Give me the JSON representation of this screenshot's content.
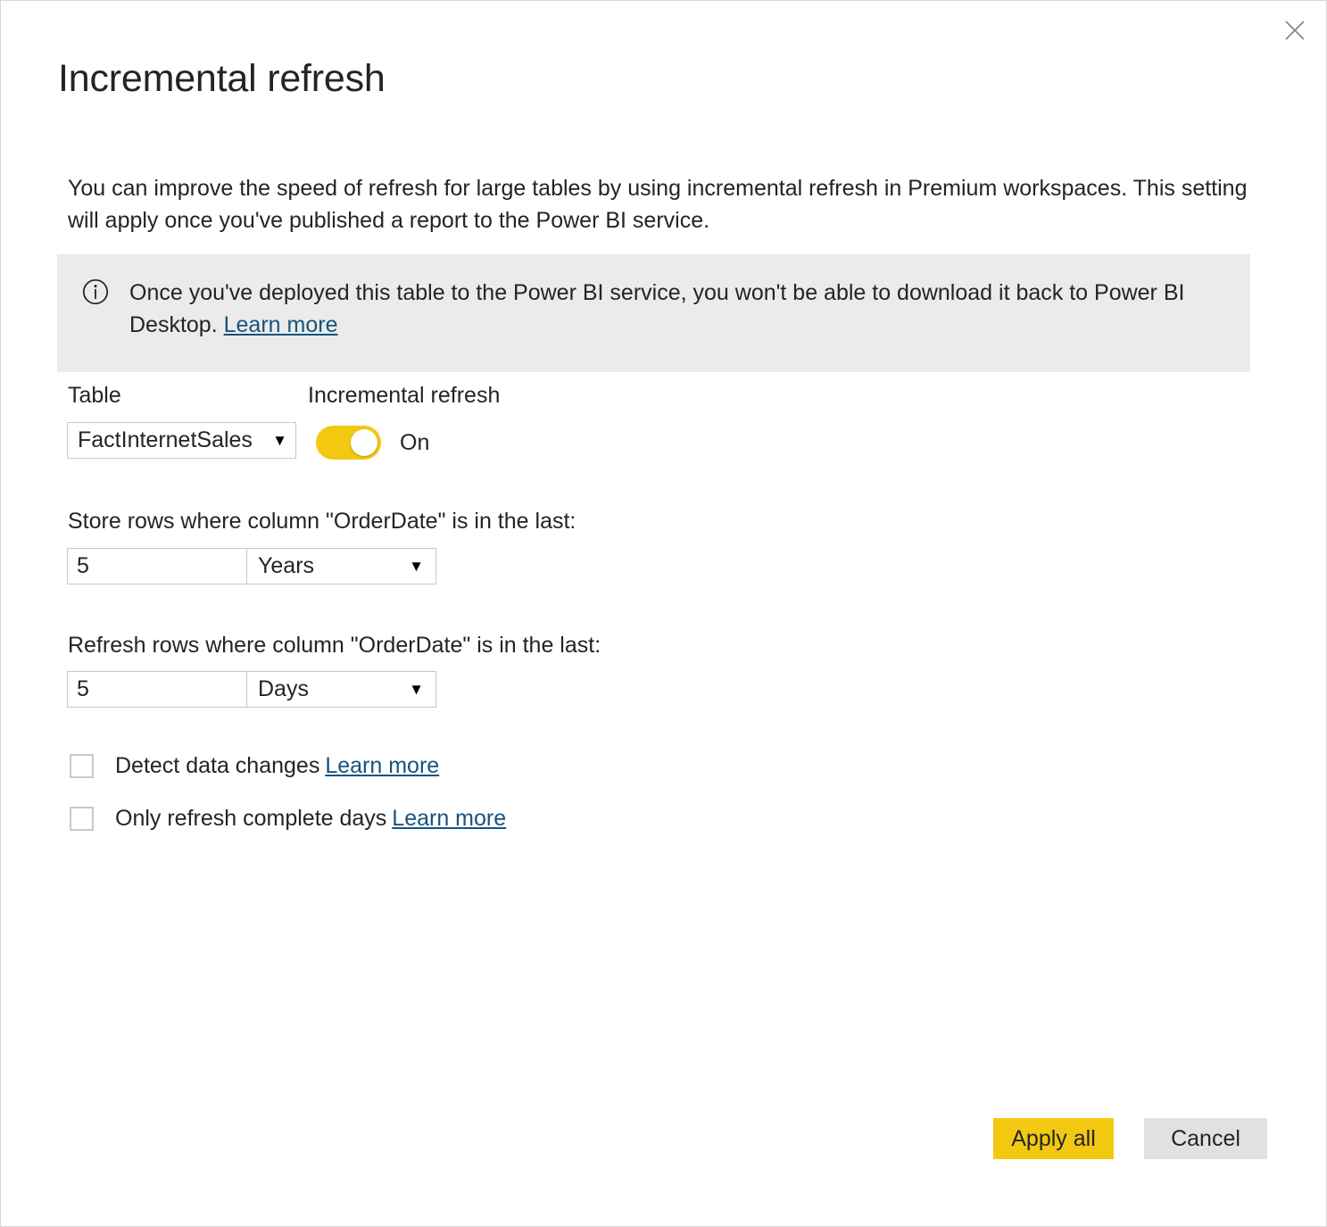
{
  "dialog": {
    "title": "Incremental refresh",
    "close_icon": "close-icon",
    "intro": "You can improve the speed of refresh for large tables by using incremental refresh in Premium workspaces. This setting will apply once you've published a report to the Power BI service."
  },
  "info_banner": {
    "icon": "info-icon",
    "text": "Once you've deployed this table to the Power BI service, you won't be able to download it back to Power BI Desktop.",
    "link_label": "Learn more"
  },
  "table_field": {
    "label": "Table",
    "selected": "FactInternetSales",
    "caret": "▼"
  },
  "incremental_refresh": {
    "label": "Incremental refresh",
    "state_label": "On",
    "enabled": true
  },
  "store_rows": {
    "label": "Store rows where column \"OrderDate\" is in the last:",
    "value": "5",
    "unit": "Years",
    "caret": "▼"
  },
  "refresh_rows": {
    "label": "Refresh rows where column \"OrderDate\" is in the last:",
    "value": "5",
    "unit": "Days",
    "caret": "▼"
  },
  "options": {
    "detect_data_changes": {
      "label": "Detect data changes",
      "link_label": "Learn more",
      "checked": false
    },
    "only_refresh_complete_days": {
      "label": "Only refresh complete days",
      "link_label": "Learn more",
      "checked": false
    }
  },
  "footer": {
    "apply_label": "Apply all",
    "cancel_label": "Cancel"
  },
  "colors": {
    "accent_yellow": "#f2c811",
    "link_blue": "#17537f",
    "banner_bg": "#ebebeb",
    "cancel_bg": "#e1e1e1",
    "border_gray": "#c8c8c8",
    "text": "#252423"
  }
}
